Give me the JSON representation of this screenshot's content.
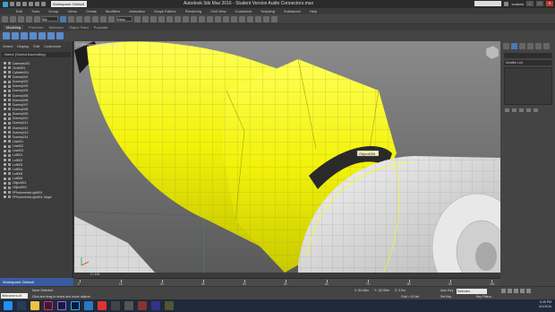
{
  "window": {
    "title": "Autodesk 3ds Max 2016 - Student Version   Audio Connectors.max",
    "workspace": "Workspace: Default",
    "signin": "scalarsi",
    "buttons": [
      "–",
      "□",
      "✕"
    ]
  },
  "menu": [
    "Edit",
    "Tools",
    "Group",
    "Views",
    "Create",
    "Modifiers",
    "Animation",
    "Graph Editors",
    "Rendering",
    "Civil View",
    "Customize",
    "Scripting",
    "Substance",
    "Help"
  ],
  "toolbar": {
    "filter": "All",
    "view": "View"
  },
  "ribbon": {
    "tabs": [
      "Modeling",
      "Freeform",
      "Selection",
      "Object Paint",
      "Populate"
    ],
    "active": 0
  },
  "explorer": {
    "tabs": [
      "Select",
      "Display",
      "Edit",
      "Customize"
    ],
    "header": "Name (Sorted Ascending)",
    "items": [
      "Cameras001",
      "Circle001",
      "Cylinder001",
      "Dummy001",
      "Dummy002",
      "Dummy003",
      "Dummy004",
      "Dummy005",
      "Dummy006",
      "Dummy007",
      "Dummy008",
      "Dummy009",
      "Dummy010",
      "Dummy011",
      "Dummy012",
      "Dummy013",
      "Dummy014",
      "Line001",
      "Line002",
      "Line003",
      "Loft001",
      "Loft002",
      "Loft003",
      "Loft004",
      "Loft005",
      "Loft006",
      "Object001",
      "Object002",
      "PPhotometricLight001",
      "PPhotometricLight001.Target"
    ]
  },
  "viewport": {
    "label": "[+] [Perspective] [Realistic]",
    "tooltip": "Object006"
  },
  "command_panel": {
    "modifier_list": "Modifier List"
  },
  "timeslider": {
    "label": "0 / 100"
  },
  "ruler_ticks": [
    "0",
    "10",
    "20",
    "30",
    "40",
    "50",
    "60",
    "70",
    "80",
    "90",
    "100"
  ],
  "status": {
    "welcome": "Welcome to M",
    "line1": "None Selected",
    "line2": "Click and drag to select and move objects",
    "x": "X: 84.48m",
    "y": "Y: -52.59m",
    "z": "Z: 0.0m",
    "grid": "Grid = 10.0m",
    "add_time_tag": "Add Time Tag",
    "auto_key": "Auto Key",
    "selected": "Selected",
    "set_key": "Set Key",
    "key_filters": "Key Filters..."
  },
  "tray": {
    "time": "6:45 PM",
    "date": "6/1/2016"
  },
  "colors": {
    "highlight": "#f2f20a",
    "workspace": "#3a5aa0"
  }
}
